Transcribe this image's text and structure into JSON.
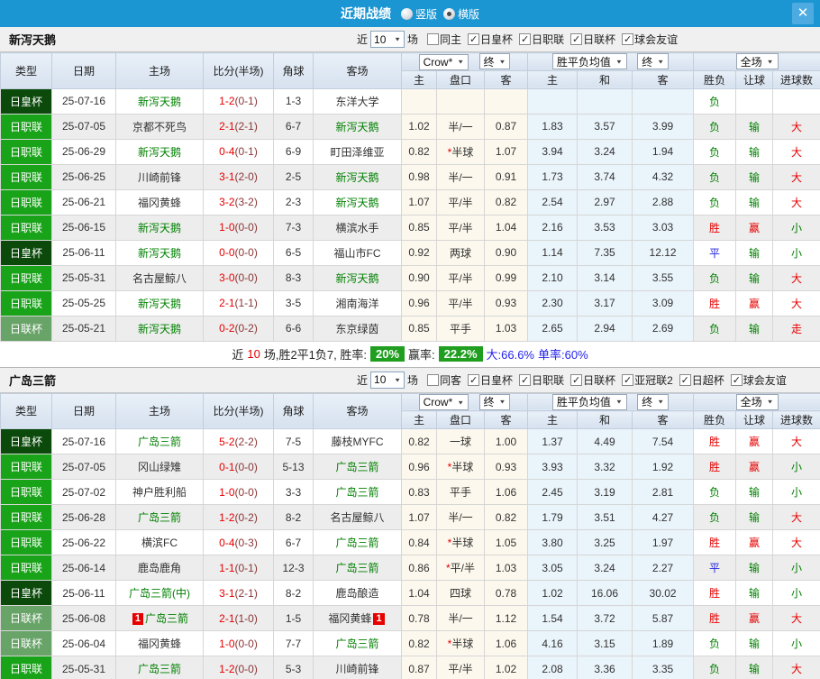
{
  "topbar": {
    "title": "近期战绩",
    "layout_options": [
      {
        "label": "竖版",
        "selected": false
      },
      {
        "label": "横版",
        "selected": true
      }
    ],
    "close_label": "✕"
  },
  "table": {
    "left_columns": [
      "类型",
      "日期",
      "主场",
      "比分(半场)",
      "角球",
      "客场"
    ],
    "dropdowns": {
      "provider": "Crow*",
      "provider_stage": "终",
      "avg": "胜平负均值",
      "avg_stage": "终",
      "scope": "全场"
    },
    "sub_columns": [
      "主",
      "盘口",
      "客",
      "主",
      "和",
      "客",
      "胜负",
      "让球",
      "进球数"
    ]
  },
  "colors": {
    "topbar_blue": "#1c96d3",
    "focus_team_green": "#008000",
    "rate_badge_green": "#1f9e1f",
    "league_badge": {
      "日皇杯": "#0b4a0b",
      "日职联": "#19a319",
      "日联杯": "#68a368"
    },
    "result": {
      "r": "#e60000",
      "g": "#008000",
      "b": "#2222dd"
    }
  },
  "sections": [
    {
      "team": "新泻天鹅",
      "filter": {
        "near": "近",
        "count": "10",
        "unit": "场",
        "mutual": {
          "label": "同主",
          "checked": false
        },
        "leagues": [
          {
            "label": "日皇杯",
            "checked": true
          },
          {
            "label": "日职联",
            "checked": true
          },
          {
            "label": "日联杯",
            "checked": true
          },
          {
            "label": "球会友谊",
            "checked": true
          }
        ]
      },
      "rows": [
        {
          "league": "日皇杯",
          "date": "25-07-16",
          "home": "新泻天鹅",
          "home_green": true,
          "home_card": "",
          "score": "1-2",
          "half": "(0-1)",
          "corners": "1-3",
          "away": "东洋大学",
          "away_green": false,
          "away_card": "",
          "odds": [
            "",
            "",
            ""
          ],
          "star": false,
          "avg": [
            "",
            "",
            ""
          ],
          "res": [
            [
              "负",
              "g"
            ],
            [
              "",
              ""
            ],
            [
              "",
              ""
            ]
          ]
        },
        {
          "league": "日职联",
          "date": "25-07-05",
          "home": "京都不死鸟",
          "home_green": false,
          "home_card": "",
          "score": "2-1",
          "half": "(2-1)",
          "corners": "6-7",
          "away": "新泻天鹅",
          "away_green": true,
          "away_card": "",
          "odds": [
            "1.02",
            "半/一",
            "0.87"
          ],
          "star": false,
          "avg": [
            "1.83",
            "3.57",
            "3.99"
          ],
          "res": [
            [
              "负",
              "g"
            ],
            [
              "输",
              "g"
            ],
            [
              "大",
              "r"
            ]
          ]
        },
        {
          "league": "日职联",
          "date": "25-06-29",
          "home": "新泻天鹅",
          "home_green": true,
          "home_card": "",
          "score": "0-4",
          "half": "(0-1)",
          "corners": "6-9",
          "away": "町田泽维亚",
          "away_green": false,
          "away_card": "",
          "odds": [
            "0.82",
            "半球",
            "1.07"
          ],
          "star": true,
          "avg": [
            "3.94",
            "3.24",
            "1.94"
          ],
          "res": [
            [
              "负",
              "g"
            ],
            [
              "输",
              "g"
            ],
            [
              "大",
              "r"
            ]
          ]
        },
        {
          "league": "日职联",
          "date": "25-06-25",
          "home": "川崎前锋",
          "home_green": false,
          "home_card": "",
          "score": "3-1",
          "half": "(2-0)",
          "corners": "2-5",
          "away": "新泻天鹅",
          "away_green": true,
          "away_card": "",
          "odds": [
            "0.98",
            "半/一",
            "0.91"
          ],
          "star": false,
          "avg": [
            "1.73",
            "3.74",
            "4.32"
          ],
          "res": [
            [
              "负",
              "g"
            ],
            [
              "输",
              "g"
            ],
            [
              "大",
              "r"
            ]
          ]
        },
        {
          "league": "日职联",
          "date": "25-06-21",
          "home": "福冈黄蜂",
          "home_green": false,
          "home_card": "",
          "score": "3-2",
          "half": "(3-2)",
          "corners": "2-3",
          "away": "新泻天鹅",
          "away_green": true,
          "away_card": "",
          "odds": [
            "1.07",
            "平/半",
            "0.82"
          ],
          "star": false,
          "avg": [
            "2.54",
            "2.97",
            "2.88"
          ],
          "res": [
            [
              "负",
              "g"
            ],
            [
              "输",
              "g"
            ],
            [
              "大",
              "r"
            ]
          ]
        },
        {
          "league": "日职联",
          "date": "25-06-15",
          "home": "新泻天鹅",
          "home_green": true,
          "home_card": "",
          "score": "1-0",
          "half": "(0-0)",
          "corners": "7-3",
          "away": "横滨水手",
          "away_green": false,
          "away_card": "",
          "odds": [
            "0.85",
            "平/半",
            "1.04"
          ],
          "star": false,
          "avg": [
            "2.16",
            "3.53",
            "3.03"
          ],
          "res": [
            [
              "胜",
              "r"
            ],
            [
              "赢",
              "r"
            ],
            [
              "小",
              "g"
            ]
          ]
        },
        {
          "league": "日皇杯",
          "date": "25-06-11",
          "home": "新泻天鹅",
          "home_green": true,
          "home_card": "",
          "score": "0-0",
          "half": "(0-0)",
          "corners": "6-5",
          "away": "福山市FC",
          "away_green": false,
          "away_card": "",
          "odds": [
            "0.92",
            "两球",
            "0.90"
          ],
          "star": false,
          "avg": [
            "1.14",
            "7.35",
            "12.12"
          ],
          "res": [
            [
              "平",
              "b"
            ],
            [
              "输",
              "g"
            ],
            [
              "小",
              "g"
            ]
          ]
        },
        {
          "league": "日职联",
          "date": "25-05-31",
          "home": "名古屋鲸八",
          "home_green": false,
          "home_card": "",
          "score": "3-0",
          "half": "(0-0)",
          "corners": "8-3",
          "away": "新泻天鹅",
          "away_green": true,
          "away_card": "",
          "odds": [
            "0.90",
            "平/半",
            "0.99"
          ],
          "star": false,
          "avg": [
            "2.10",
            "3.14",
            "3.55"
          ],
          "res": [
            [
              "负",
              "g"
            ],
            [
              "输",
              "g"
            ],
            [
              "大",
              "r"
            ]
          ]
        },
        {
          "league": "日职联",
          "date": "25-05-25",
          "home": "新泻天鹅",
          "home_green": true,
          "home_card": "",
          "score": "2-1",
          "half": "(1-1)",
          "corners": "3-5",
          "away": "湘南海洋",
          "away_green": false,
          "away_card": "",
          "odds": [
            "0.96",
            "平/半",
            "0.93"
          ],
          "star": false,
          "avg": [
            "2.30",
            "3.17",
            "3.09"
          ],
          "res": [
            [
              "胜",
              "r"
            ],
            [
              "赢",
              "r"
            ],
            [
              "大",
              "r"
            ]
          ]
        },
        {
          "league": "日联杯",
          "date": "25-05-21",
          "home": "新泻天鹅",
          "home_green": true,
          "home_card": "",
          "score": "0-2",
          "half": "(0-2)",
          "corners": "6-6",
          "away": "东京绿茵",
          "away_green": false,
          "away_card": "",
          "odds": [
            "0.85",
            "平手",
            "1.03"
          ],
          "star": false,
          "avg": [
            "2.65",
            "2.94",
            "2.69"
          ],
          "res": [
            [
              "负",
              "g"
            ],
            [
              "输",
              "g"
            ],
            [
              "走",
              "r"
            ]
          ]
        }
      ],
      "summary": [
        [
          "近",
          "t"
        ],
        [
          "10",
          "red"
        ],
        [
          "场,胜2平1负7, 胜率:",
          "t"
        ],
        [
          "20%",
          "box"
        ],
        [
          "赢率:",
          "t"
        ],
        [
          "22.2%",
          "box"
        ],
        [
          "大:66.6%",
          "blue"
        ],
        [
          "单率:60%",
          "blue"
        ]
      ]
    },
    {
      "team": "广岛三箭",
      "filter": {
        "near": "近",
        "count": "10",
        "unit": "场",
        "mutual": {
          "label": "同客",
          "checked": false
        },
        "leagues": [
          {
            "label": "日皇杯",
            "checked": true
          },
          {
            "label": "日职联",
            "checked": true
          },
          {
            "label": "日联杯",
            "checked": true
          },
          {
            "label": "亚冠联2",
            "checked": true
          },
          {
            "label": "日超杯",
            "checked": true
          },
          {
            "label": "球会友谊",
            "checked": true
          }
        ]
      },
      "rows": [
        {
          "league": "日皇杯",
          "date": "25-07-16",
          "home": "广岛三箭",
          "home_green": true,
          "home_card": "",
          "score": "5-2",
          "half": "(2-2)",
          "corners": "7-5",
          "away": "藤枝MYFC",
          "away_green": false,
          "away_card": "",
          "odds": [
            "0.82",
            "一球",
            "1.00"
          ],
          "star": false,
          "avg": [
            "1.37",
            "4.49",
            "7.54"
          ],
          "res": [
            [
              "胜",
              "r"
            ],
            [
              "赢",
              "r"
            ],
            [
              "大",
              "r"
            ]
          ]
        },
        {
          "league": "日职联",
          "date": "25-07-05",
          "home": "冈山绿雉",
          "home_green": false,
          "home_card": "",
          "score": "0-1",
          "half": "(0-0)",
          "corners": "5-13",
          "away": "广岛三箭",
          "away_green": true,
          "away_card": "",
          "odds": [
            "0.96",
            "半球",
            "0.93"
          ],
          "star": true,
          "avg": [
            "3.93",
            "3.32",
            "1.92"
          ],
          "res": [
            [
              "胜",
              "r"
            ],
            [
              "赢",
              "r"
            ],
            [
              "小",
              "g"
            ]
          ]
        },
        {
          "league": "日职联",
          "date": "25-07-02",
          "home": "神户胜利船",
          "home_green": false,
          "home_card": "",
          "score": "1-0",
          "half": "(0-0)",
          "corners": "3-3",
          "away": "广岛三箭",
          "away_green": true,
          "away_card": "",
          "odds": [
            "0.83",
            "平手",
            "1.06"
          ],
          "star": false,
          "avg": [
            "2.45",
            "3.19",
            "2.81"
          ],
          "res": [
            [
              "负",
              "g"
            ],
            [
              "输",
              "g"
            ],
            [
              "小",
              "g"
            ]
          ]
        },
        {
          "league": "日职联",
          "date": "25-06-28",
          "home": "广岛三箭",
          "home_green": true,
          "home_card": "",
          "score": "1-2",
          "half": "(0-2)",
          "corners": "8-2",
          "away": "名古屋鲸八",
          "away_green": false,
          "away_card": "",
          "odds": [
            "1.07",
            "半/一",
            "0.82"
          ],
          "star": false,
          "avg": [
            "1.79",
            "3.51",
            "4.27"
          ],
          "res": [
            [
              "负",
              "g"
            ],
            [
              "输",
              "g"
            ],
            [
              "大",
              "r"
            ]
          ]
        },
        {
          "league": "日职联",
          "date": "25-06-22",
          "home": "横滨FC",
          "home_green": false,
          "home_card": "",
          "score": "0-4",
          "half": "(0-3)",
          "corners": "6-7",
          "away": "广岛三箭",
          "away_green": true,
          "away_card": "",
          "odds": [
            "0.84",
            "半球",
            "1.05"
          ],
          "star": true,
          "avg": [
            "3.80",
            "3.25",
            "1.97"
          ],
          "res": [
            [
              "胜",
              "r"
            ],
            [
              "赢",
              "r"
            ],
            [
              "大",
              "r"
            ]
          ]
        },
        {
          "league": "日职联",
          "date": "25-06-14",
          "home": "鹿岛鹿角",
          "home_green": false,
          "home_card": "",
          "score": "1-1",
          "half": "(0-1)",
          "corners": "12-3",
          "away": "广岛三箭",
          "away_green": true,
          "away_card": "",
          "odds": [
            "0.86",
            "平/半",
            "1.03"
          ],
          "star": true,
          "avg": [
            "3.05",
            "3.24",
            "2.27"
          ],
          "res": [
            [
              "平",
              "b"
            ],
            [
              "输",
              "g"
            ],
            [
              "小",
              "g"
            ]
          ]
        },
        {
          "league": "日皇杯",
          "date": "25-06-11",
          "home": "广岛三箭(中)",
          "home_green": true,
          "home_card": "",
          "score": "3-1",
          "half": "(2-1)",
          "corners": "8-2",
          "away": "鹿岛酿造",
          "away_green": false,
          "away_card": "",
          "odds": [
            "1.04",
            "四球",
            "0.78"
          ],
          "star": false,
          "avg": [
            "1.02",
            "16.06",
            "30.02"
          ],
          "res": [
            [
              "胜",
              "r"
            ],
            [
              "输",
              "g"
            ],
            [
              "小",
              "g"
            ]
          ]
        },
        {
          "league": "日联杯",
          "date": "25-06-08",
          "home": "广岛三箭",
          "home_green": true,
          "home_card": "1",
          "score": "2-1",
          "half": "(1-0)",
          "corners": "1-5",
          "away": "福冈黄蜂",
          "away_green": false,
          "away_card": "1",
          "odds": [
            "0.78",
            "半/一",
            "1.12"
          ],
          "star": false,
          "avg": [
            "1.54",
            "3.72",
            "5.87"
          ],
          "res": [
            [
              "胜",
              "r"
            ],
            [
              "赢",
              "r"
            ],
            [
              "大",
              "r"
            ]
          ]
        },
        {
          "league": "日联杯",
          "date": "25-06-04",
          "home": "福冈黄蜂",
          "home_green": false,
          "home_card": "",
          "score": "1-0",
          "half": "(0-0)",
          "corners": "7-7",
          "away": "广岛三箭",
          "away_green": true,
          "away_card": "",
          "odds": [
            "0.82",
            "半球",
            "1.06"
          ],
          "star": true,
          "avg": [
            "4.16",
            "3.15",
            "1.89"
          ],
          "res": [
            [
              "负",
              "g"
            ],
            [
              "输",
              "g"
            ],
            [
              "小",
              "g"
            ]
          ]
        },
        {
          "league": "日职联",
          "date": "25-05-31",
          "home": "广岛三箭",
          "home_green": true,
          "home_card": "",
          "score": "1-2",
          "half": "(0-0)",
          "corners": "5-3",
          "away": "川崎前锋",
          "away_green": false,
          "away_card": "",
          "odds": [
            "0.87",
            "平/半",
            "1.02"
          ],
          "star": false,
          "avg": [
            "2.08",
            "3.36",
            "3.35"
          ],
          "res": [
            [
              "负",
              "g"
            ],
            [
              "输",
              "g"
            ],
            [
              "大",
              "r"
            ]
          ]
        }
      ],
      "summary": null
    }
  ]
}
